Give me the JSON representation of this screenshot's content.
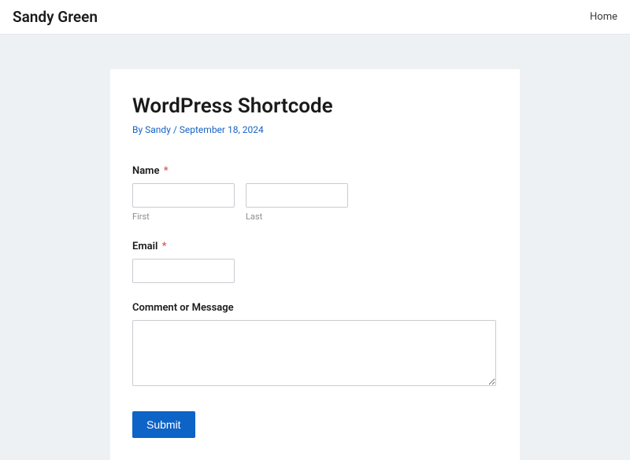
{
  "header": {
    "site_title": "Sandy Green",
    "nav": {
      "home": "Home"
    }
  },
  "post": {
    "title": "WordPress Shortcode",
    "by_prefix": "By ",
    "author": "Sandy",
    "separator": " / ",
    "date": "September 18, 2024"
  },
  "form": {
    "name": {
      "label": "Name",
      "required_mark": "*",
      "first_sublabel": "First",
      "last_sublabel": "Last",
      "first_value": "",
      "last_value": ""
    },
    "email": {
      "label": "Email",
      "required_mark": "*",
      "value": ""
    },
    "message": {
      "label": "Comment or Message",
      "value": ""
    },
    "submit_label": "Submit"
  }
}
